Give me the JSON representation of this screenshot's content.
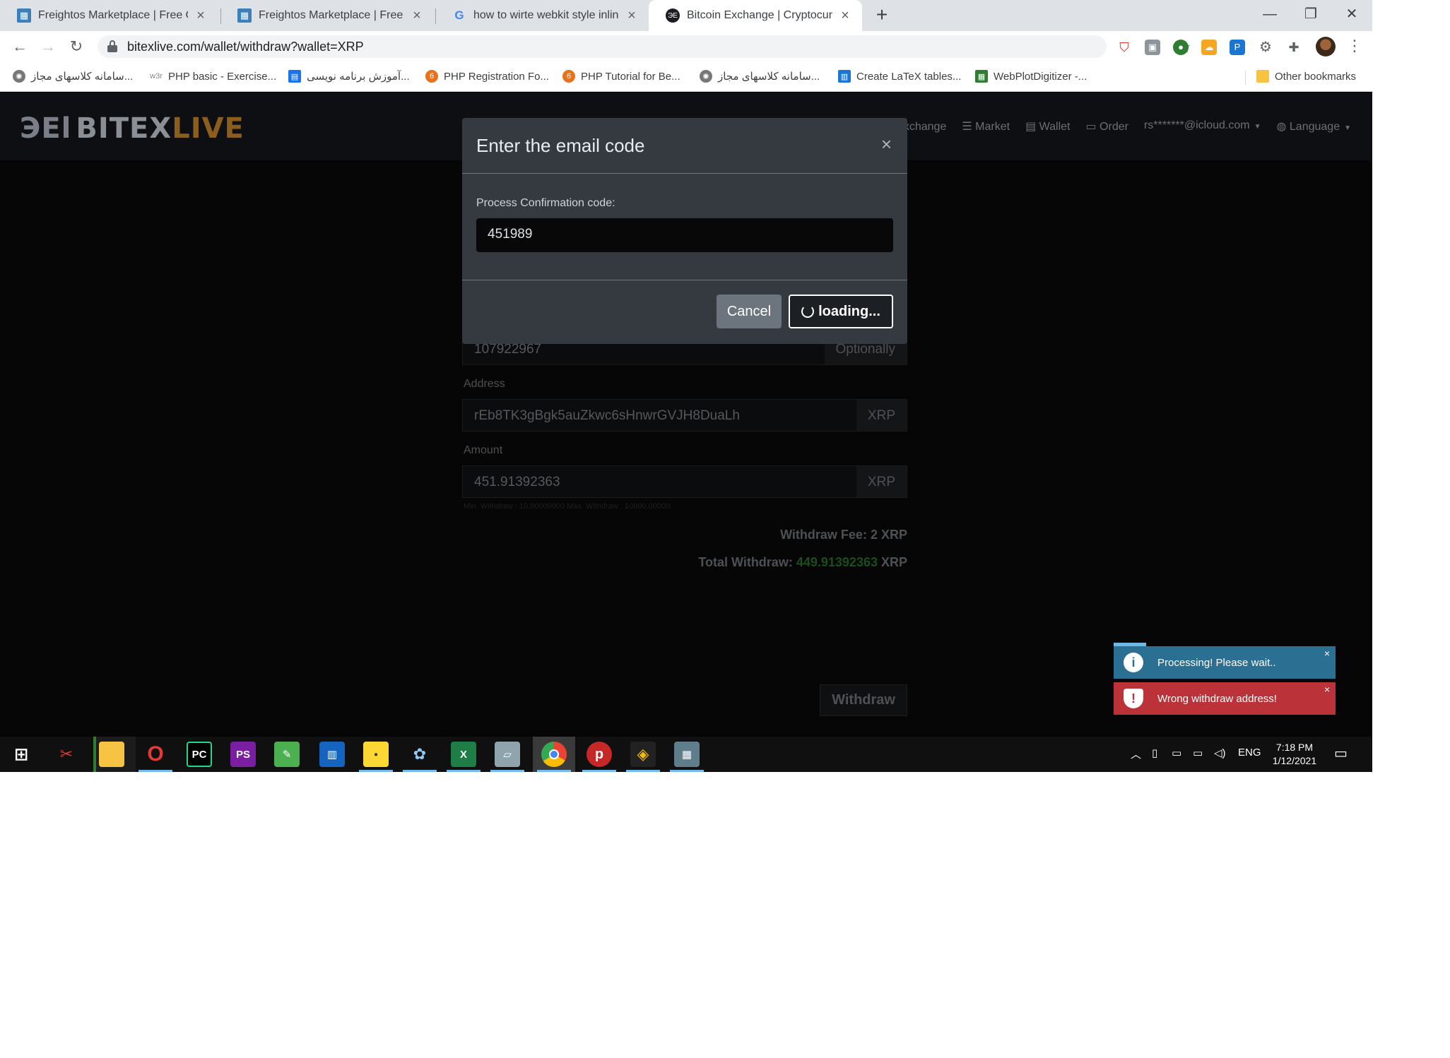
{
  "browser": {
    "tabs": [
      {
        "title": "Freightos Marketplace | Free Onli",
        "active": false
      },
      {
        "title": "Freightos Marketplace | Free Onli",
        "active": false
      },
      {
        "title": "how to wirte webkit style inline -",
        "active": false
      },
      {
        "title": "Bitcoin Exchange | Cryptocurrenc",
        "active": true
      }
    ],
    "new_tab": "+",
    "url": "bitexlive.com/wallet/withdraw?wallet=XRP",
    "bookmarks": [
      "سامانه کلاسهای مجاز...",
      "PHP basic - Exercise...",
      "آموزش برنامه نویسی...",
      "PHP Registration Fo...",
      "PHP Tutorial for Be...",
      "سامانه کلاسهای مجاز...",
      "Create LaTeX tables...",
      "WebPlotDigitizer -..."
    ],
    "other_bookmarks": "Other bookmarks"
  },
  "site": {
    "logo_mark": "ЭЕl",
    "logo_bitex": "BITEX",
    "logo_live": "LIVE",
    "nav": [
      "Exchange",
      "Market",
      "Wallet",
      "Order"
    ],
    "user": "rs*******@icloud.com",
    "language": "Language"
  },
  "form": {
    "tag_value": "107922967",
    "tag_addon": "Optionally",
    "address_label": "Address",
    "address_value": "rEb8TK3gBgk5auZkwc6sHnwrGVJH8DuaLh",
    "address_addon": "XRP",
    "amount_label": "Amount",
    "amount_value": "451.91392363",
    "amount_addon": "XRP",
    "minmax": "Min. Withdraw : 10.00000000 Max. Withdraw : 10000.00000",
    "fee_label": "Withdraw Fee:",
    "fee_value": "2 XRP",
    "total_label": "Total Withdraw:",
    "total_amount": "449.91392363",
    "total_unit": "XRP",
    "withdraw_button": "Withdraw"
  },
  "modal": {
    "title": "Enter the email code",
    "close": "×",
    "code_label": "Process Confirmation code:",
    "code_value": "451989",
    "cancel_button": "Cancel",
    "loading_button": "loading..."
  },
  "toasts": [
    {
      "type": "info",
      "message": "Processing! Please wait..",
      "close": "×"
    },
    {
      "type": "error",
      "message": "Wrong withdraw address!",
      "close": "×"
    }
  ],
  "taskbar": {
    "language": "ENG",
    "time": "7:18 PM",
    "date": "1/12/2021"
  },
  "colors": {
    "modal_bg": "#343a40",
    "info_toast": "#2b6f93",
    "error_toast": "#bb3339",
    "total_green": "#1b4d1e"
  }
}
